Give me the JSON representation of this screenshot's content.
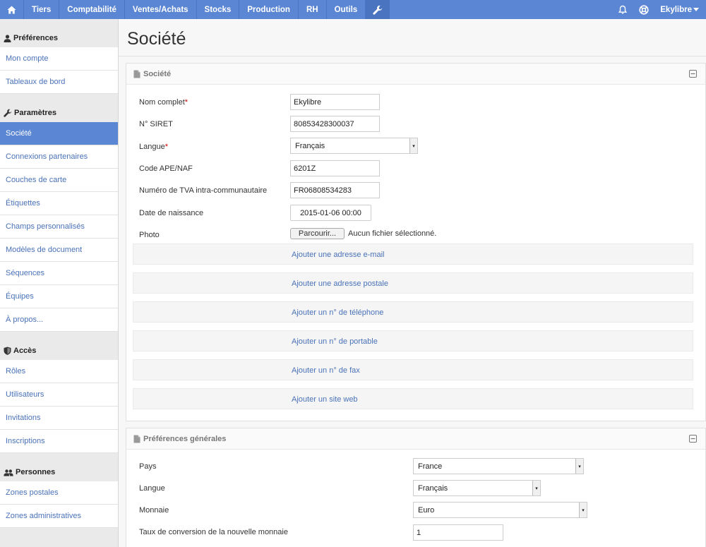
{
  "topnav": {
    "items": [
      "Tiers",
      "Comptabilité",
      "Ventes/Achats",
      "Stocks",
      "Production",
      "RH",
      "Outils"
    ],
    "user": "Ekylibre"
  },
  "sidebar": {
    "sections": [
      {
        "title": "Préférences",
        "icon": "user-icon",
        "items": [
          "Mon compte",
          "Tableaux de bord"
        ]
      },
      {
        "title": "Paramètres",
        "icon": "wrench-icon",
        "items": [
          "Société",
          "Connexions partenaires",
          "Couches de carte",
          "Étiquettes",
          "Champs personnalisés",
          "Modèles de document",
          "Séquences",
          "Équipes",
          "À propos..."
        ]
      },
      {
        "title": "Accès",
        "icon": "shield-icon",
        "items": [
          "Rôles",
          "Utilisateurs",
          "Invitations",
          "Inscriptions"
        ]
      },
      {
        "title": "Personnes",
        "icon": "people-icon",
        "items": [
          "Zones postales",
          "Zones administratives"
        ]
      }
    ],
    "active": "Société"
  },
  "page": {
    "title": "Société"
  },
  "company_panel": {
    "title": "Société",
    "fields": {
      "full_name": {
        "label": "Nom complet",
        "required": "*",
        "value": "Ekylibre"
      },
      "siret": {
        "label": "N° SIRET",
        "value": "80853428300037"
      },
      "language": {
        "label": "Langue",
        "required": "*",
        "value": "Français"
      },
      "ape": {
        "label": "Code APE/NAF",
        "value": "6201Z"
      },
      "vat": {
        "label": "Numéro de TVA intra-communautaire",
        "value": "FR06808534283"
      },
      "birth": {
        "label": "Date de naissance",
        "value": "2015-01-06 00:00"
      },
      "photo": {
        "label": "Photo",
        "button": "Parcourir...",
        "note": "Aucun fichier sélectionné."
      }
    },
    "add_links": [
      "Ajouter une adresse e-mail",
      "Ajouter une adresse postale",
      "Ajouter un n° de téléphone",
      "Ajouter un n° de portable",
      "Ajouter un n° de fax",
      "Ajouter un site web"
    ]
  },
  "prefs_panel": {
    "title": "Préférences générales",
    "fields": {
      "country": {
        "label": "Pays",
        "value": "France"
      },
      "language": {
        "label": "Langue",
        "value": "Français"
      },
      "currency": {
        "label": "Monnaie",
        "value": "Euro"
      },
      "rate": {
        "label": "Taux de conversion de la nouvelle monnaie",
        "value": "1"
      }
    }
  },
  "colors": {
    "accent": "#5b86d3",
    "link": "#4a72b8",
    "required": "#cc0000"
  }
}
